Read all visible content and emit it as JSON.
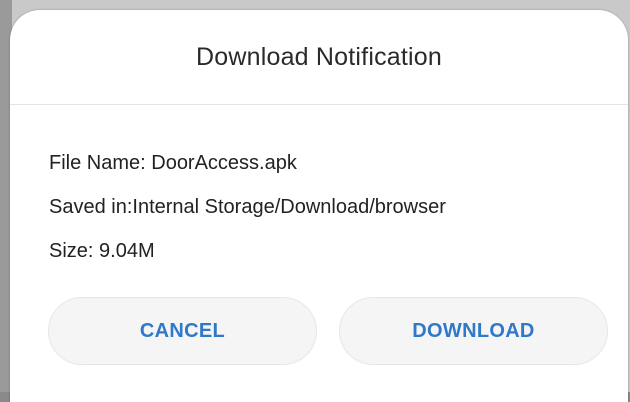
{
  "dialog": {
    "title": "Download Notification",
    "file_name_line": "File Name: DoorAccess.apk",
    "saved_in_line": "Saved in:Internal Storage/Download/browser",
    "size_line": "Size: 9.04M",
    "cancel_label": "CANCEL",
    "download_label": "DOWNLOAD"
  },
  "colors": {
    "accent": "#2f79c8",
    "dialog_background": "#ffffff",
    "button_background": "#f5f5f5"
  }
}
